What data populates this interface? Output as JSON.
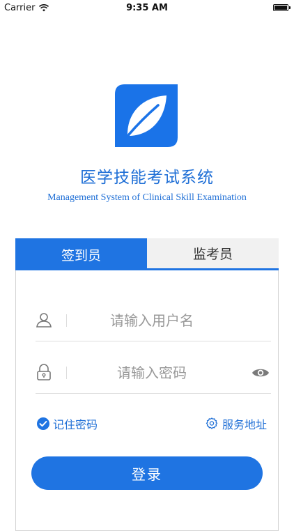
{
  "status_bar": {
    "carrier": "Carrier",
    "time": "9:35 AM",
    "battery_level": 1.0
  },
  "app": {
    "title": "医学技能考试系统",
    "subtitle": "Management System of Clinical Skill Examination",
    "logo_color": "#1a73e8"
  },
  "tabs": [
    {
      "label": "签到员",
      "active": true
    },
    {
      "label": "监考员",
      "active": false
    }
  ],
  "form": {
    "username_placeholder": "请输入用户名",
    "password_placeholder": "请输入密码",
    "remember_label": "记住密码",
    "remember_checked": true,
    "service_label": "服务地址",
    "login_label": "登录"
  },
  "colors": {
    "accent": "#1f74e2",
    "text_accent": "#1f6fd6",
    "placeholder": "#999999"
  },
  "icons": {
    "wifi": "wifi-icon",
    "battery": "battery-icon",
    "user": "user-icon",
    "lock": "lock-icon",
    "eye": "eye-icon",
    "check": "check-circle-icon",
    "gear": "gear-icon",
    "leaf": "leaf-icon"
  }
}
